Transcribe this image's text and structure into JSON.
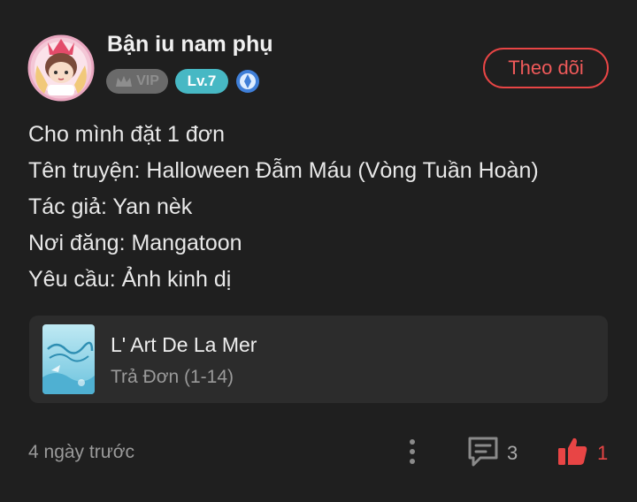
{
  "post": {
    "author": {
      "name": "Bận iu nam phụ",
      "vip_label": "VIP",
      "level_label": "Lv.7",
      "avatar_icon": "chibi-avatar-with-crown",
      "medal_icon": "blue-medal-icon"
    },
    "follow_label": "Theo dõi",
    "lines": [
      "Cho mình đặt 1 đơn",
      "Tên truyện: Halloween Đẫm Máu (Vòng Tuần Hoàn)",
      "Tác giả: Yan nèk",
      "Nơi đăng: Mangatoon",
      "Yêu cầu: Ảnh kinh dị"
    ],
    "card": {
      "title": "L' Art De La Mer",
      "subtitle": "Trả Đơn (1-14)",
      "thumb_icon": "book-cover-thumbnail"
    },
    "time": "4 ngày trước",
    "comment_count": "3",
    "like_count": "1"
  },
  "colors": {
    "background": "#1f1f1f",
    "accent_red": "#e84545",
    "level_teal": "#47b8c4",
    "vip_gray": "#6a6a6a",
    "card_bg": "#2c2c2c"
  }
}
